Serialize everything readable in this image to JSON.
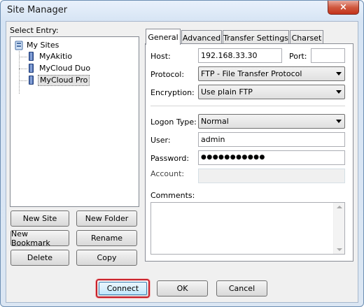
{
  "window": {
    "title": "Site Manager",
    "close_glyph": "×"
  },
  "select_entry_label": "Select Entry:",
  "tree": {
    "root": "My Sites",
    "items": [
      {
        "label": "MyAkitio"
      },
      {
        "label": "MyCloud Duo"
      },
      {
        "label": "MyCloud Pro",
        "selected": true
      }
    ]
  },
  "left_buttons": {
    "new_site": "New Site",
    "new_folder": "New Folder",
    "new_bookmark": "New Bookmark",
    "rename": "Rename",
    "delete": "Delete",
    "copy": "Copy"
  },
  "tabs": [
    {
      "label": "General",
      "active": true
    },
    {
      "label": "Advanced"
    },
    {
      "label": "Transfer Settings"
    },
    {
      "label": "Charset"
    }
  ],
  "general": {
    "host_label": "Host:",
    "host_value": "192.168.33.30",
    "port_label": "Port:",
    "port_value": "",
    "protocol_label": "Protocol:",
    "protocol_value": "FTP - File Transfer Protocol",
    "encryption_label": "Encryption:",
    "encryption_value": "Use plain FTP",
    "logon_type_label": "Logon Type:",
    "logon_type_value": "Normal",
    "user_label": "User:",
    "user_value": "admin",
    "password_label": "Password:",
    "password_value": "●●●●●●●●●●●",
    "account_label": "Account:",
    "account_value": "",
    "comments_label": "Comments:",
    "comments_value": ""
  },
  "bottom_buttons": {
    "connect": "Connect",
    "ok": "OK",
    "cancel": "Cancel"
  },
  "colors": {
    "connect_highlight": "#c8202a",
    "close_button": "#c3331b"
  }
}
